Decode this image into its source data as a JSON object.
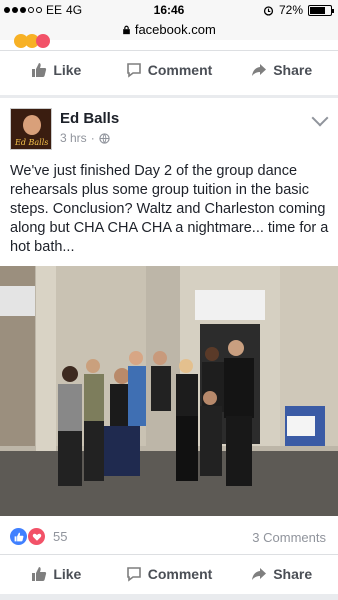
{
  "status_bar": {
    "carrier": "EE",
    "network": "4G",
    "time": "16:46",
    "battery": "72%"
  },
  "url_bar": {
    "domain": "facebook.com"
  },
  "previous_post": {
    "actions": {
      "like": "Like",
      "comment": "Comment",
      "share": "Share"
    }
  },
  "post": {
    "author": "Ed Balls",
    "avatar_text": "Ed Balls",
    "time": "3 hrs",
    "text": "We've just finished Day 2 of the group dance rehearsals plus some group tuition in the basic steps. Conclusion? Waltz and Charleston coming along but CHA CHA CHA a nightmare... time for a hot bath...",
    "reaction_count": "55",
    "comments_count": "3 Comments",
    "actions": {
      "like": "Like",
      "comment": "Comment",
      "share": "Share"
    }
  },
  "colors": {
    "facebook_blue": "#4080ff",
    "love_red": "#f25268",
    "secondary_text": "#90949c"
  }
}
